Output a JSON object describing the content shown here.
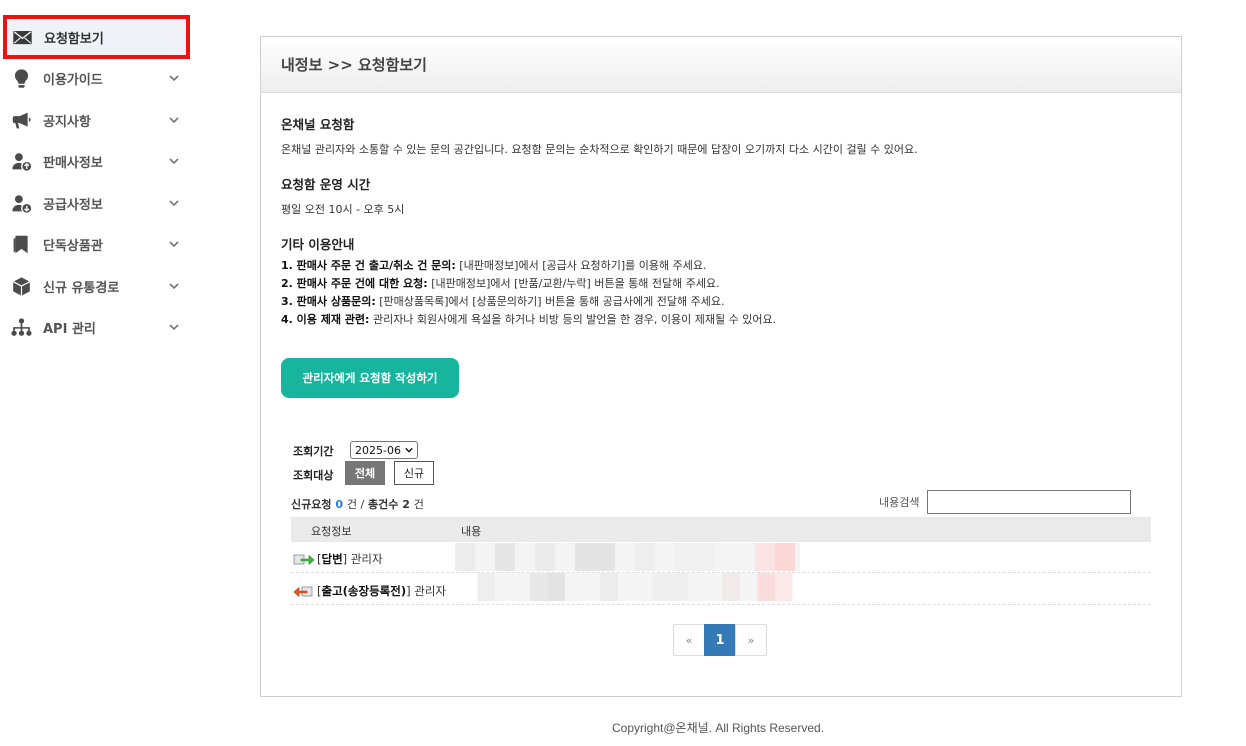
{
  "sidebar": {
    "items": [
      {
        "label": "요청함보기",
        "icon": "envelope-icon",
        "active": true
      },
      {
        "label": "이용가이드",
        "icon": "lightbulb-icon"
      },
      {
        "label": "공지사항",
        "icon": "megaphone-icon"
      },
      {
        "label": "판매사정보",
        "icon": "user-up-icon"
      },
      {
        "label": "공급사정보",
        "icon": "user-down-icon"
      },
      {
        "label": "단독상품관",
        "icon": "bookmark-icon"
      },
      {
        "label": "신규 유통경로",
        "icon": "box-icon"
      },
      {
        "label": "API 관리",
        "icon": "sitemap-icon"
      }
    ],
    "active_border_color": "#ee1111"
  },
  "panel": {
    "breadcrumb": "내정보 >> 요청함보기",
    "sections": [
      {
        "title": "온채널 요청함",
        "text": "온채널 관리자와 소통할 수 있는 문의 공간입니다. 요청함 문의는 순차적으로 확인하기 때문에 답장이 오기까지 다소 시간이 걸릴 수 있어요."
      },
      {
        "title": "요청함 운영 시간",
        "text": "평일 오전 10시 - 오후 5시"
      },
      {
        "title": "기타 이용안내",
        "lines": [
          {
            "bold": "1. 판매사 주문 건 출고/취소 건 문의:",
            "rest": " [내판매정보]에서 [공급사 요청하기]를 이용해 주세요."
          },
          {
            "bold": "2. 판매사 주문 건에 대한 요청:",
            "rest": " [내판매정보]에서 [반품/교환/누락] 버튼을 통해 전달해 주세요."
          },
          {
            "bold": "3. 판매사 상품문의:",
            "rest": " [판매상품목록]에서 [상품문의하기] 버튼을 통해 공급사에게 전달해 주세요."
          },
          {
            "bold": "4. 이용 제재 관련:",
            "rest": " 관리자나 회원사에게 욕설을 하거나 비방 등의 발언을 한 경우, 이용이 제재될 수 있어요."
          }
        ]
      }
    ],
    "write_button": "관리자에게 요청함 작성하기",
    "accent_color": "#17b59e"
  },
  "filter": {
    "period_label": "조회기간",
    "period_value": "2025-06",
    "target_label": "조회대상",
    "target_all": "전체",
    "target_new": "신규"
  },
  "summary": {
    "new_label": "신규요청",
    "new_count": "0",
    "new_unit": "건 /",
    "total_label": "총건수",
    "total_count": "2",
    "total_unit": "건"
  },
  "search": {
    "label": "내용검색",
    "value": ""
  },
  "table": {
    "headers": [
      "요청정보",
      "내용"
    ],
    "rows": [
      {
        "icon": "reply-arrow-icon",
        "tag": "답변",
        "author": "관리자"
      },
      {
        "icon": "shipping-arrow-icon",
        "tag": "출고(송장등록전)",
        "author": "관리자"
      }
    ]
  },
  "pagination": {
    "prev": "«",
    "current": "1",
    "next": "»"
  },
  "footer": "Copyright@온채널. All Rights Reserved."
}
